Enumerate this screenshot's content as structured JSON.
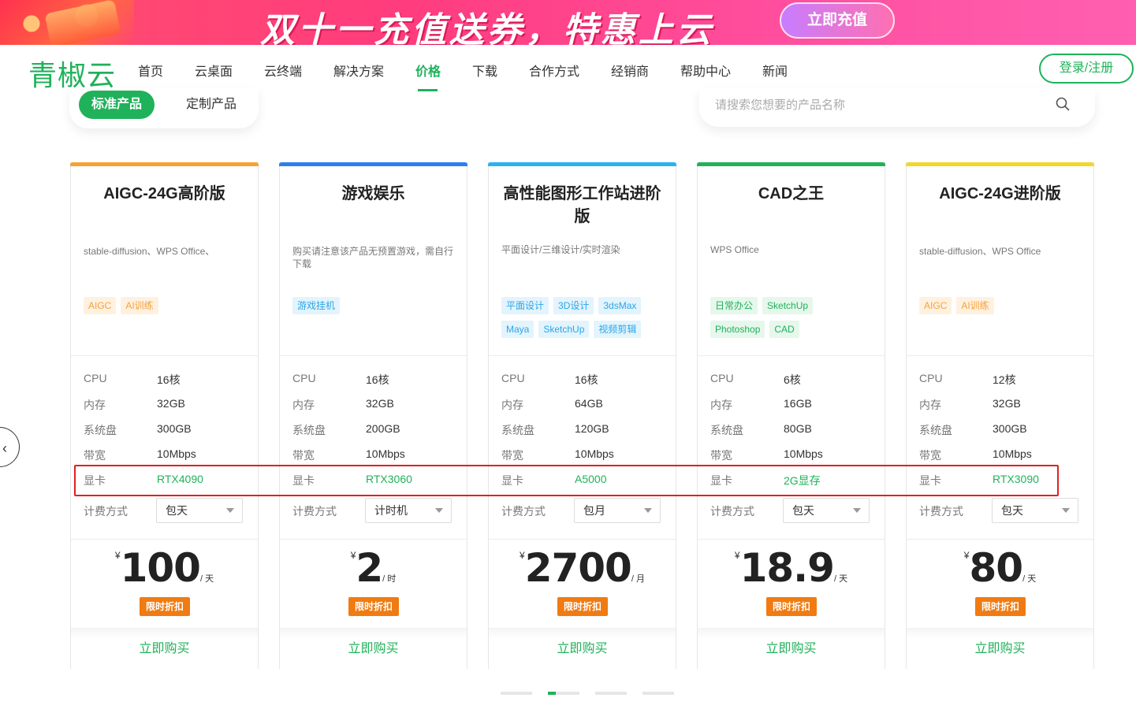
{
  "banner": {
    "title": "双十一充值送券，特惠上云",
    "button": "立即充值"
  },
  "nav": {
    "logo": "青椒云",
    "items": [
      "首页",
      "云桌面",
      "云终端",
      "解决方案",
      "价格",
      "下载",
      "合作方式",
      "经销商",
      "帮助中心",
      "新闻"
    ],
    "active": "价格",
    "login": "登录/注册"
  },
  "toggle": {
    "active": "标准产品",
    "inactive": "定制产品"
  },
  "search": {
    "placeholder": "请搜索您想要的产品名称"
  },
  "spec_labels": {
    "cpu": "CPU",
    "memory": "内存",
    "disk": "系统盘",
    "bandwidth": "带宽",
    "gpu": "显卡",
    "billing": "计费方式"
  },
  "colors": {
    "brand": "#1fb25a",
    "badge": "#f07b12",
    "highlight": "#e02020"
  },
  "cards": [
    {
      "title": "AIGC-24G高阶版",
      "desc": "stable-diffusion、WPS Office、",
      "tags": [
        "AIGC",
        "AI训练"
      ],
      "tag_color": "orange",
      "cpu": "16核",
      "memory": "32GB",
      "disk": "300GB",
      "bandwidth": "10Mbps",
      "gpu": "RTX4090",
      "billing": "包天",
      "currency": "¥",
      "price": "100",
      "unit": "/ 天",
      "badge": "限时折扣",
      "buy": "立即购买",
      "accent": "#f7a135"
    },
    {
      "title": "游戏娱乐",
      "desc": "购买请注意该产品无预置游戏，需自行下载",
      "tags": [
        "游戏挂机"
      ],
      "tag_color": "blue",
      "cpu": "16核",
      "memory": "32GB",
      "disk": "200GB",
      "bandwidth": "10Mbps",
      "gpu": "RTX3060",
      "billing": "计时机",
      "currency": "¥",
      "price": "2",
      "unit": "/ 时",
      "badge": "限时折扣",
      "buy": "立即购买",
      "accent": "#2d7ff0"
    },
    {
      "title": "高性能图形工作站进阶版",
      "desc": "平面设计/三维设计/实时渲染",
      "tags": [
        "平面设计",
        "3D设计",
        "3dsMax",
        "Maya",
        "SketchUp",
        "视频剪辑"
      ],
      "tag_color": "blue",
      "cpu": "16核",
      "memory": "64GB",
      "disk": "120GB",
      "bandwidth": "10Mbps",
      "gpu": "A5000",
      "billing": "包月",
      "currency": "¥",
      "price": "2700",
      "unit": "/ 月",
      "badge": "限时折扣",
      "buy": "立即购买",
      "accent": "#27b4f0"
    },
    {
      "title": "CAD之王",
      "desc": "WPS Office",
      "tags": [
        "日常办公",
        "SketchUp",
        "Photoshop",
        "CAD"
      ],
      "tag_color": "green",
      "cpu": "6核",
      "memory": "16GB",
      "disk": "80GB",
      "bandwidth": "10Mbps",
      "gpu": "2G显存",
      "billing": "包天",
      "currency": "¥",
      "price": "18.9",
      "unit": "/ 天",
      "badge": "限时折扣",
      "buy": "立即购买",
      "accent": "#1fb25a"
    },
    {
      "title": "AIGC-24G进阶版",
      "desc": "stable-diffusion、WPS Office",
      "tags": [
        "AIGC",
        "AI训练"
      ],
      "tag_color": "orange",
      "cpu": "12核",
      "memory": "32GB",
      "disk": "300GB",
      "bandwidth": "10Mbps",
      "gpu": "RTX3090",
      "billing": "包天",
      "currency": "¥",
      "price": "80",
      "unit": "/ 天",
      "badge": "限时折扣",
      "buy": "立即购买",
      "accent": "#f5d630"
    }
  ],
  "carousel": {
    "pages": 4,
    "active_page": 2
  }
}
